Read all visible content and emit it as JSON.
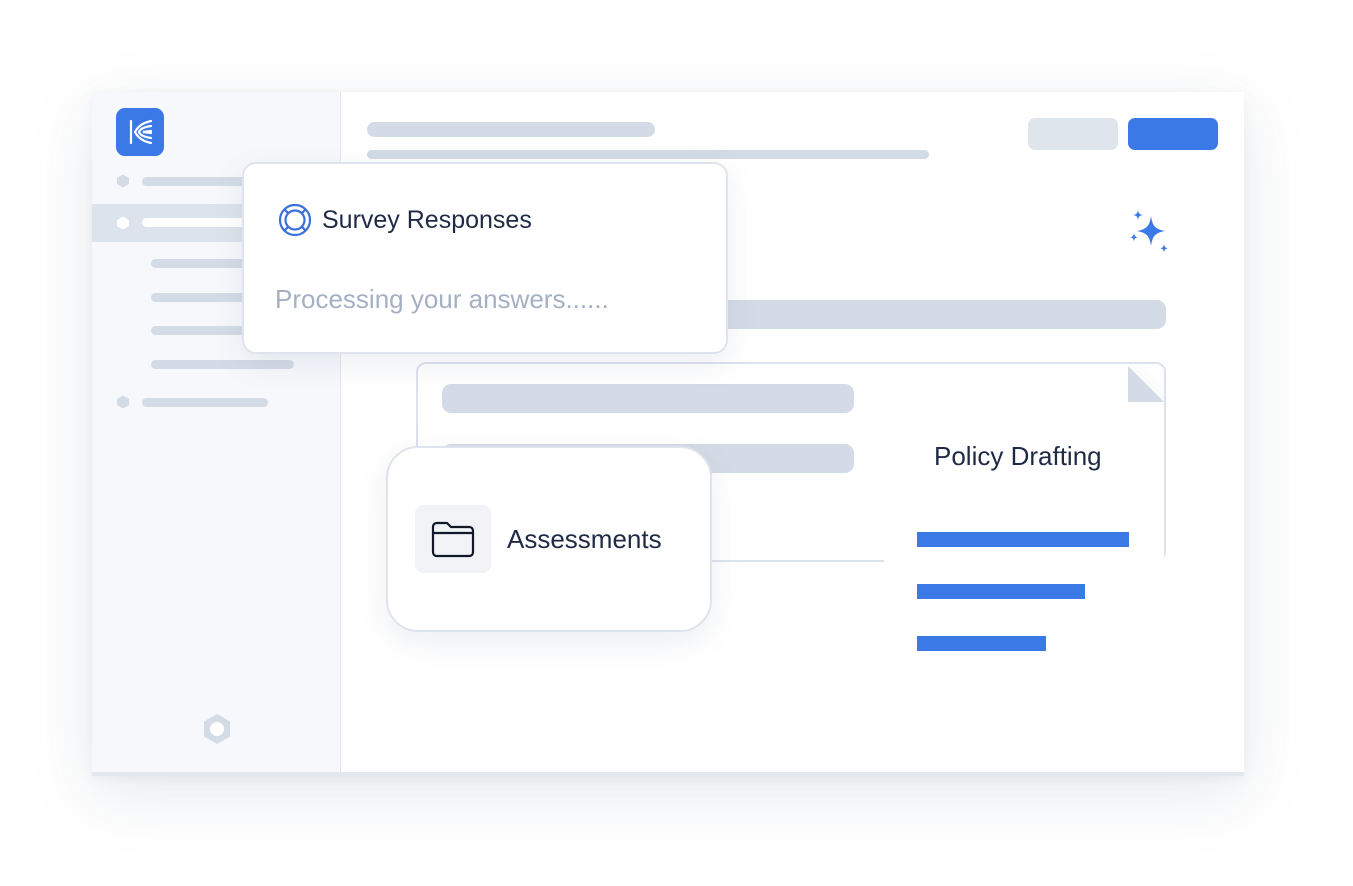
{
  "survey_card": {
    "title": "Survey Responses",
    "status": "Processing your answers......",
    "icon": "globe-icon"
  },
  "assessments_card": {
    "label": "Assessments",
    "icon": "folder-icon"
  },
  "document": {
    "title": "Policy Drafting",
    "icon": "document-icon"
  },
  "icons": {
    "logo": "app-logo-icon",
    "sparkle": "sparkle-icon",
    "settings": "gear-icon",
    "nav": "hexagon-icon"
  },
  "colors": {
    "accent": "#3b79e6",
    "placeholder": "#d3dbe6",
    "heading": "#1f2a44",
    "muted_text": "#a5b0c4",
    "sidebar_bg": "#f6f8fb",
    "active_row": "#dde3ec"
  }
}
